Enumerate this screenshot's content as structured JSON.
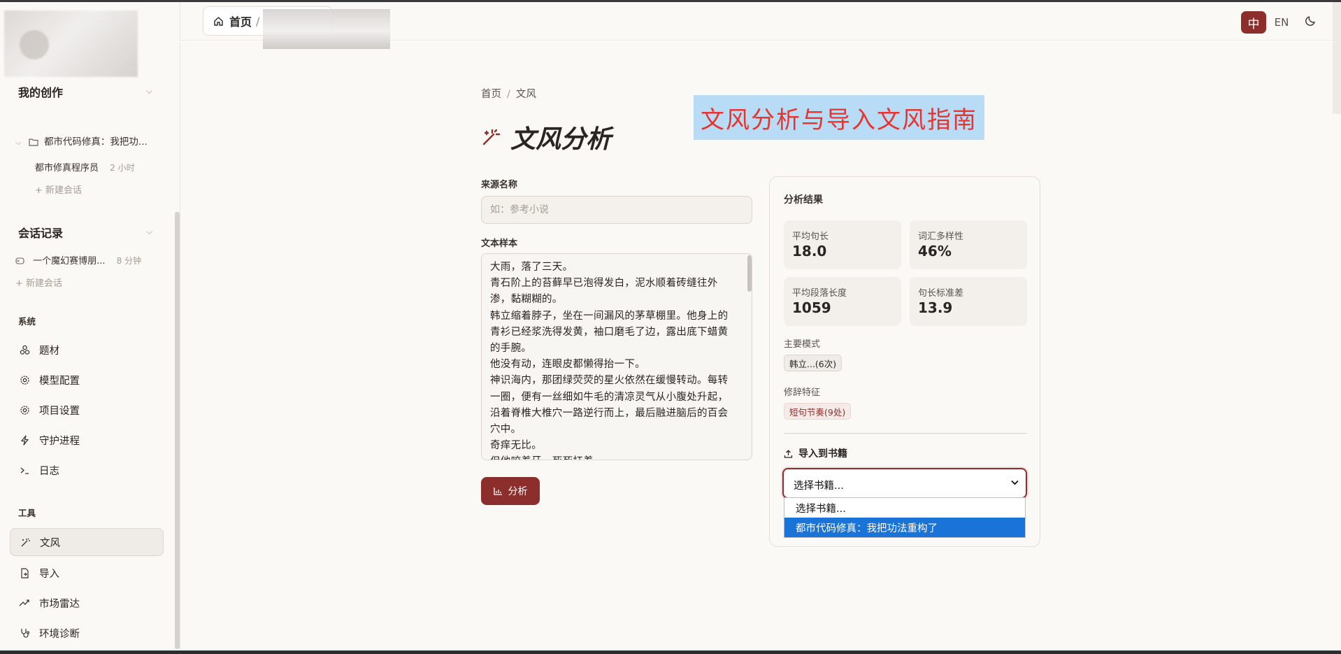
{
  "topbar": {
    "home_label": "首页",
    "lang_zh": "中",
    "lang_en": "EN"
  },
  "sidebar": {
    "my_works_title": "我的创作",
    "project_name": "都市代码修真：我把功...",
    "session_name": "都市修真程序员",
    "session_time": "2 小时",
    "new_session_1": "+ 新建会话",
    "history_title": "会话记录",
    "history_item": "一个魔幻赛博朋...",
    "history_time": "8 分钟",
    "new_session_2": "+ 新建会话",
    "system_label": "系统",
    "system_items": [
      {
        "label": "题材",
        "icon": "nodes-icon"
      },
      {
        "label": "模型配置",
        "icon": "gear-icon"
      },
      {
        "label": "项目设置",
        "icon": "gear-icon"
      },
      {
        "label": "守护进程",
        "icon": "bolt-icon"
      },
      {
        "label": "日志",
        "icon": "terminal-icon"
      }
    ],
    "tools_label": "工具",
    "tool_items": [
      {
        "label": "文风",
        "icon": "magic-wand-icon"
      },
      {
        "label": "导入",
        "icon": "file-import-icon"
      },
      {
        "label": "市场雷达",
        "icon": "trend-icon"
      },
      {
        "label": "环境诊断",
        "icon": "stethoscope-icon"
      }
    ]
  },
  "main": {
    "breadcrumb": [
      "首页",
      "文风"
    ],
    "banner": "文风分析与导入文风指南",
    "title": "文风分析",
    "source_label": "来源名称",
    "source_placeholder": "如：参考小说",
    "sample_label": "文本样本",
    "sample_text": "大雨，落了三天。\n青石阶上的苔藓早已泡得发白，泥水顺着砖缝往外渗，黏糊糊的。\n韩立缩着脖子，坐在一间漏风的茅草棚里。他身上的青衫已经浆洗得发黄，袖口磨毛了边，露出底下蜡黄的手腕。\n他没有动，连眼皮都懒得抬一下。\n神识海内，那团绿荧荧的星火依然在缓慢转动。每转一圈，便有一丝细如牛毛的清凉灵气从小腹处升起，沿着脊椎大椎穴一路逆行而上，最后融进脑后的百会穴中。\n奇痒无比。\n但他咬着牙，死死扛着。",
    "analyze_button": "分析"
  },
  "results": {
    "title": "分析结果",
    "stats": [
      {
        "label": "平均句长",
        "value": "18.0"
      },
      {
        "label": "词汇多样性",
        "value": "46%"
      },
      {
        "label": "平均段落长度",
        "value": "1059"
      },
      {
        "label": "句长标准差",
        "value": "13.9"
      }
    ],
    "main_patterns_label": "主要模式",
    "main_pattern_tag": "韩立...(6次)",
    "rhetoric_label": "修辞特征",
    "rhetoric_tag": "短句节奏(9处)",
    "import_label": "导入到书籍",
    "select_value": "选择书籍...",
    "options": [
      "选择书籍...",
      "都市代码修真：我把功法重构了"
    ]
  },
  "colors": {
    "accent": "#8c2f2c",
    "banner_bg": "#b8dcf6",
    "banner_text": "#e8342f",
    "option_selected": "#1a73d6"
  }
}
